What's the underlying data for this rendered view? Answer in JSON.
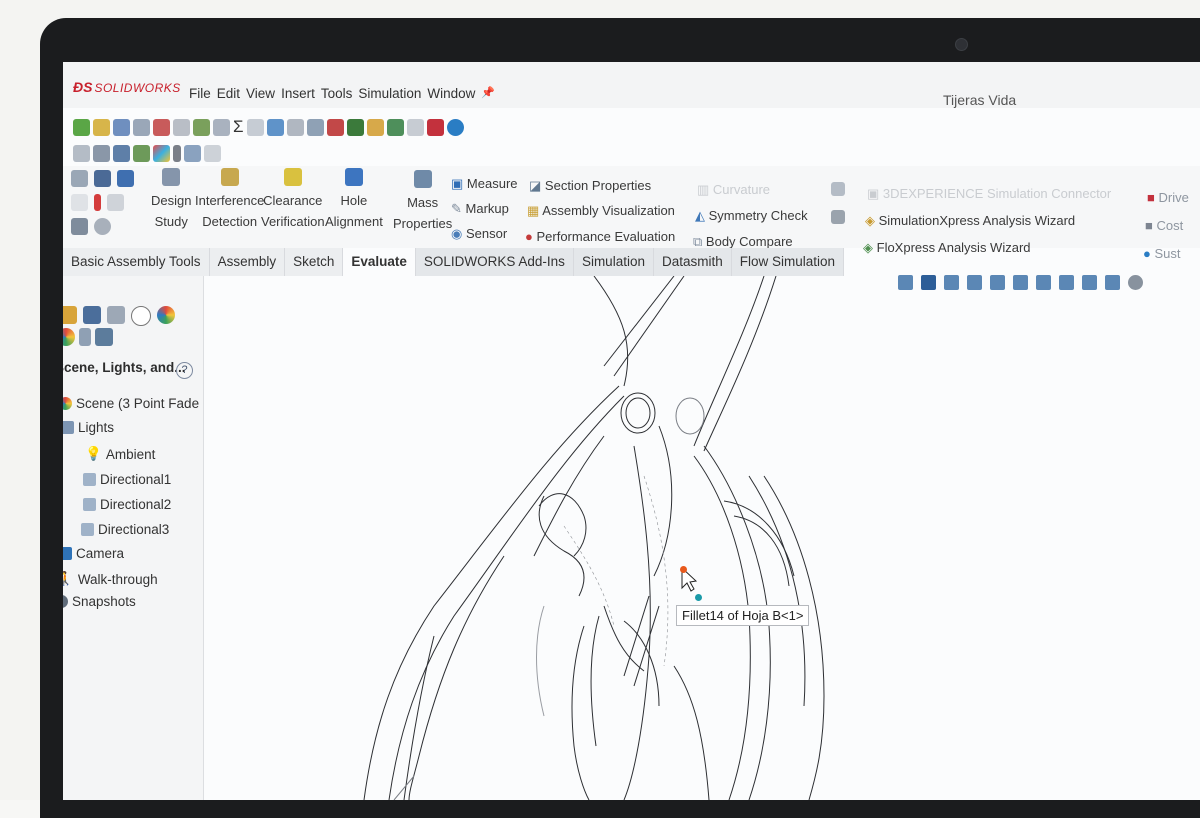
{
  "app": {
    "logo_text": "SOLIDWORKS",
    "document_title": "Tijeras Vida"
  },
  "menu": [
    "File",
    "Edit",
    "View",
    "Insert",
    "Tools",
    "Simulation",
    "Window"
  ],
  "ribbon": {
    "design_study": [
      "Design",
      "Study"
    ],
    "interference": [
      "Interference",
      "Detection"
    ],
    "clearance": [
      "Clearance",
      "Verification"
    ],
    "hole": [
      "Hole",
      "Alignment"
    ],
    "mass": [
      "Mass",
      "Properties"
    ],
    "col1": [
      "Measure",
      "Markup",
      "Sensor"
    ],
    "col2": [
      "Section Properties",
      "Assembly Visualization",
      "Performance Evaluation"
    ],
    "col3": [
      "Curvature",
      "Symmetry Check",
      "Body Compare"
    ],
    "col4": [
      "3DEXPERIENCE Simulation Connector",
      "SimulationXpress Analysis Wizard",
      "FloXpress Analysis Wizard"
    ],
    "col5": [
      "Drive",
      "Cost",
      "Sust"
    ]
  },
  "tabs": [
    "Basic Assembly Tools",
    "Assembly",
    "Sketch",
    "Evaluate",
    "SOLIDWORKS Add-Ins",
    "Simulation",
    "Datasmith",
    "Flow Simulation"
  ],
  "active_tab": "Evaluate",
  "panel": {
    "title": "Scene, Lights, and...",
    "help": "?",
    "tree": [
      "Scene (3 Point Fade",
      "Lights",
      "Ambient",
      "Directional1",
      "Directional2",
      "Directional3",
      "Camera",
      "Walk-through",
      "Snapshots"
    ]
  },
  "viewport": {
    "tooltip": "Fillet14 of Hoja B<1>"
  },
  "colors": {
    "brand": "#c8202c",
    "selection_dot": "#e8591c",
    "pick_dot": "#1a9aa8"
  }
}
